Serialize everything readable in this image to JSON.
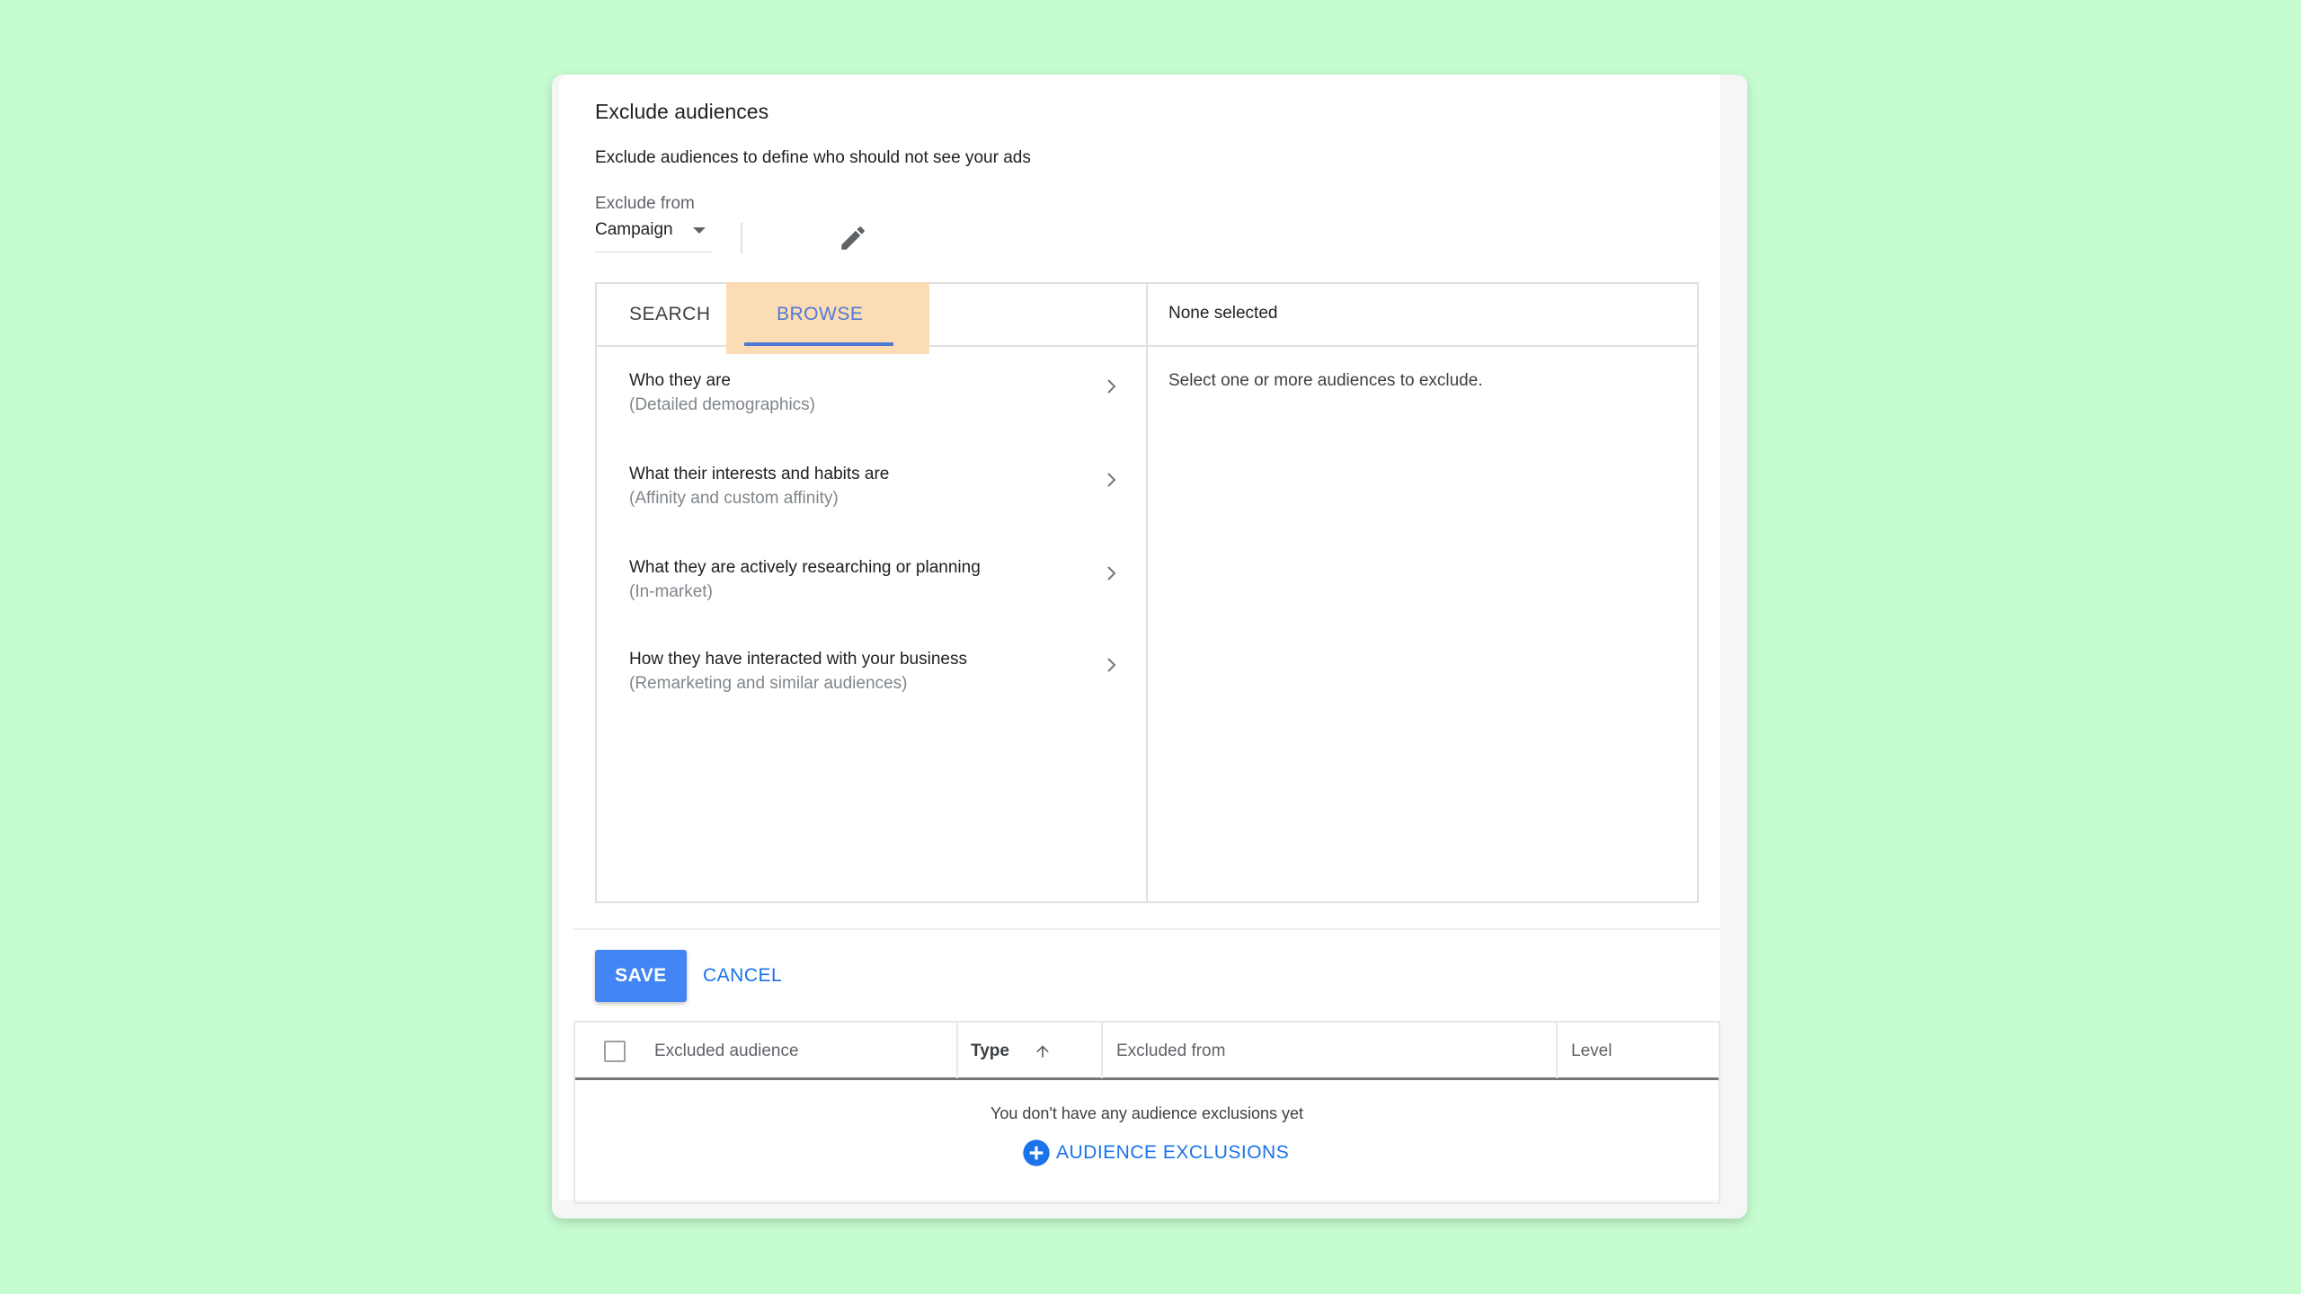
{
  "dialog": {
    "title": "Exclude audiences",
    "subtitle": "Exclude audiences to define who should not see your ads",
    "exclude_from_label": "Exclude from",
    "exclude_from_value": "Campaign"
  },
  "tabs": {
    "search": "SEARCH",
    "browse": "BROWSE",
    "active": "browse"
  },
  "categories": [
    {
      "label": "Who they are",
      "sub": "(Detailed demographics)"
    },
    {
      "label": "What their interests and habits are",
      "sub": "(Affinity and custom affinity)"
    },
    {
      "label": "What they are actively researching or planning",
      "sub": "(In-market)"
    },
    {
      "label": "How they have interacted with your business",
      "sub": "(Remarketing and similar audiences)"
    }
  ],
  "selection": {
    "header": "None selected",
    "hint": "Select one or more audiences to exclude."
  },
  "actions": {
    "save": "SAVE",
    "cancel": "CANCEL"
  },
  "table": {
    "columns": [
      "Excluded audience",
      "Type",
      "Excluded from",
      "Level"
    ],
    "empty_message": "You don't have any audience exclusions yet",
    "add_label": "AUDIENCE EXCLUSIONS"
  },
  "colors": {
    "background": "#c6fdd0",
    "highlight": "#fbdcb4",
    "accent": "#4285f4",
    "link": "#1a73e8"
  },
  "icons": [
    "dropdown-caret-icon",
    "pencil-icon",
    "chevron-right-icon",
    "sort-arrow-up-icon",
    "add-circle-icon",
    "checkbox-icon"
  ]
}
